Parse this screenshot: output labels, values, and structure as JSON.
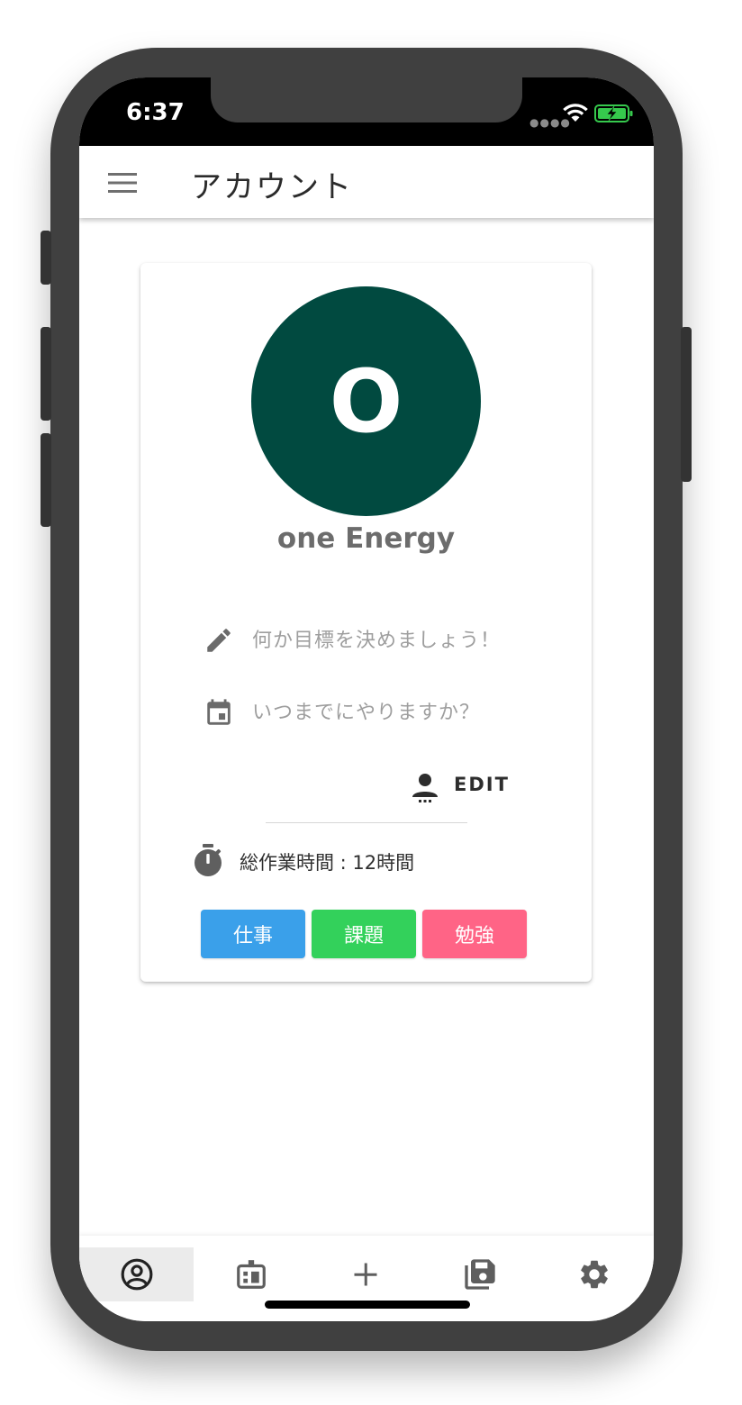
{
  "status_bar": {
    "time": "6:37"
  },
  "app_bar": {
    "title": "アカウント",
    "menu_icon": "menu-icon"
  },
  "profile": {
    "avatar_initial": "O",
    "avatar_color": "#014a40",
    "name": "one Energy",
    "goal_placeholder": "何か目標を決めましょう！",
    "deadline_placeholder": "いつまでにやりますか？",
    "edit_label": "EDIT",
    "total_time_label": "総作業時間 : 12時間"
  },
  "tags": [
    {
      "label": "仕事",
      "color": "#3aa0ea"
    },
    {
      "label": "課題",
      "color": "#33d15b"
    },
    {
      "label": "勉強",
      "color": "#ff6486"
    }
  ],
  "bottom_nav": {
    "items": [
      {
        "icon": "account-circle-icon",
        "active": true
      },
      {
        "icon": "domain-icon",
        "active": false
      },
      {
        "icon": "add-icon",
        "active": false
      },
      {
        "icon": "library-save-icon",
        "active": false
      },
      {
        "icon": "settings-icon",
        "active": false
      }
    ]
  }
}
